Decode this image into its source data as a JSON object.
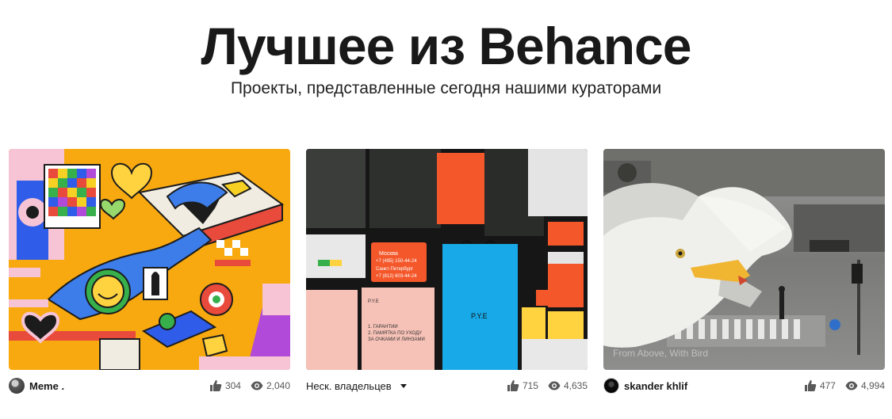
{
  "header": {
    "title": "Лучшее из Behance",
    "subtitle": "Проекты, представленные сегодня нашими кураторами"
  },
  "projects": [
    {
      "owner": "Meme .",
      "appreciations": "304",
      "views": "2,040",
      "colors": {
        "bg": "#f7a90f",
        "accent": "#2f5ce8"
      }
    },
    {
      "owner": "Неск. владельцев",
      "appreciations": "715",
      "views": "4,635",
      "colors": {
        "bg": "#161616",
        "accent": "#f4572a",
        "bag": "#18a9e8"
      },
      "artwork_text": [
        "P.Y.E",
        "Москва",
        "+7 (495) 150-44-24",
        "Санкт-Петербург",
        "+7 (812) 603-44-24",
        "1. ГАРАНТИИ",
        "2. ПАМЯТКА ПО УХОДУ",
        "ЗА ОЧКАМИ И ЛИНЗАМИ"
      ]
    },
    {
      "owner": "skander khlif",
      "appreciations": "477",
      "views": "4,994",
      "colors": {
        "bg": "#7d7d7d",
        "accent": "#f0b531"
      },
      "artwork_text": [
        "From Above, With Bird"
      ]
    }
  ]
}
